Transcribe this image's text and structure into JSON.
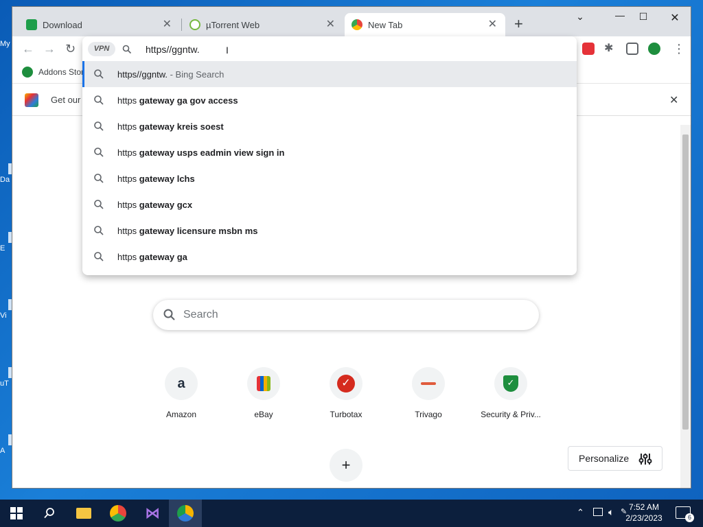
{
  "desktop": {
    "icons": [
      {
        "label": "My"
      },
      {
        "label": "Da"
      },
      {
        "label": "E"
      },
      {
        "label": "Vi"
      },
      {
        "label": "uT"
      },
      {
        "label": "A"
      }
    ]
  },
  "browser": {
    "tabs": [
      {
        "title": "Download",
        "favicon_color": "#1e9e4a",
        "icon": "download-favicon"
      },
      {
        "title": "µTorrent Web",
        "favicon_color": "#76b83f",
        "icon": "utorrent-favicon"
      },
      {
        "title": "New Tab",
        "favicon_color": "#e8453c",
        "icon": "chrome-favicon"
      }
    ],
    "active_tab": 2,
    "omnibox": {
      "vpn_label": "VPN",
      "input_value": "https//ggntw."
    },
    "suggestions": [
      {
        "plain": "https//ggntw.",
        "bold": "",
        "suffix": " - Bing Search"
      },
      {
        "plain": "https ",
        "bold": "gateway ga gov access",
        "suffix": ""
      },
      {
        "plain": "https ",
        "bold": "gateway kreis soest",
        "suffix": ""
      },
      {
        "plain": "https ",
        "bold": "gateway usps eadmin view sign in",
        "suffix": ""
      },
      {
        "plain": "https ",
        "bold": "gateway lchs",
        "suffix": ""
      },
      {
        "plain": "https ",
        "bold": "gateway gcx",
        "suffix": ""
      },
      {
        "plain": "https ",
        "bold": "gateway licensure msbn ms",
        "suffix": ""
      },
      {
        "plain": "https ",
        "bold": "gateway ga",
        "suffix": ""
      }
    ],
    "bookmarks": {
      "item": "Addons Stor"
    },
    "infobar": {
      "text": "Get our"
    },
    "newtab": {
      "search_placeholder": "Search",
      "shortcuts": [
        {
          "label": "Amazon",
          "icon": "amazon-icon",
          "color": "#232f3e"
        },
        {
          "label": "eBay",
          "icon": "ebay-icon",
          "color": "#e53238"
        },
        {
          "label": "Turbotax",
          "icon": "turbotax-icon",
          "color": "#d52b1e"
        },
        {
          "label": "Trivago",
          "icon": "trivago-icon",
          "color": "#e05b3c"
        },
        {
          "label": "Security & Priv...",
          "icon": "security-shield-icon",
          "color": "#1e8e3e"
        }
      ],
      "personalize_label": "Personalize"
    }
  },
  "taskbar": {
    "time": "7:52 AM",
    "date": "2/23/2023",
    "notification_count": "6"
  }
}
